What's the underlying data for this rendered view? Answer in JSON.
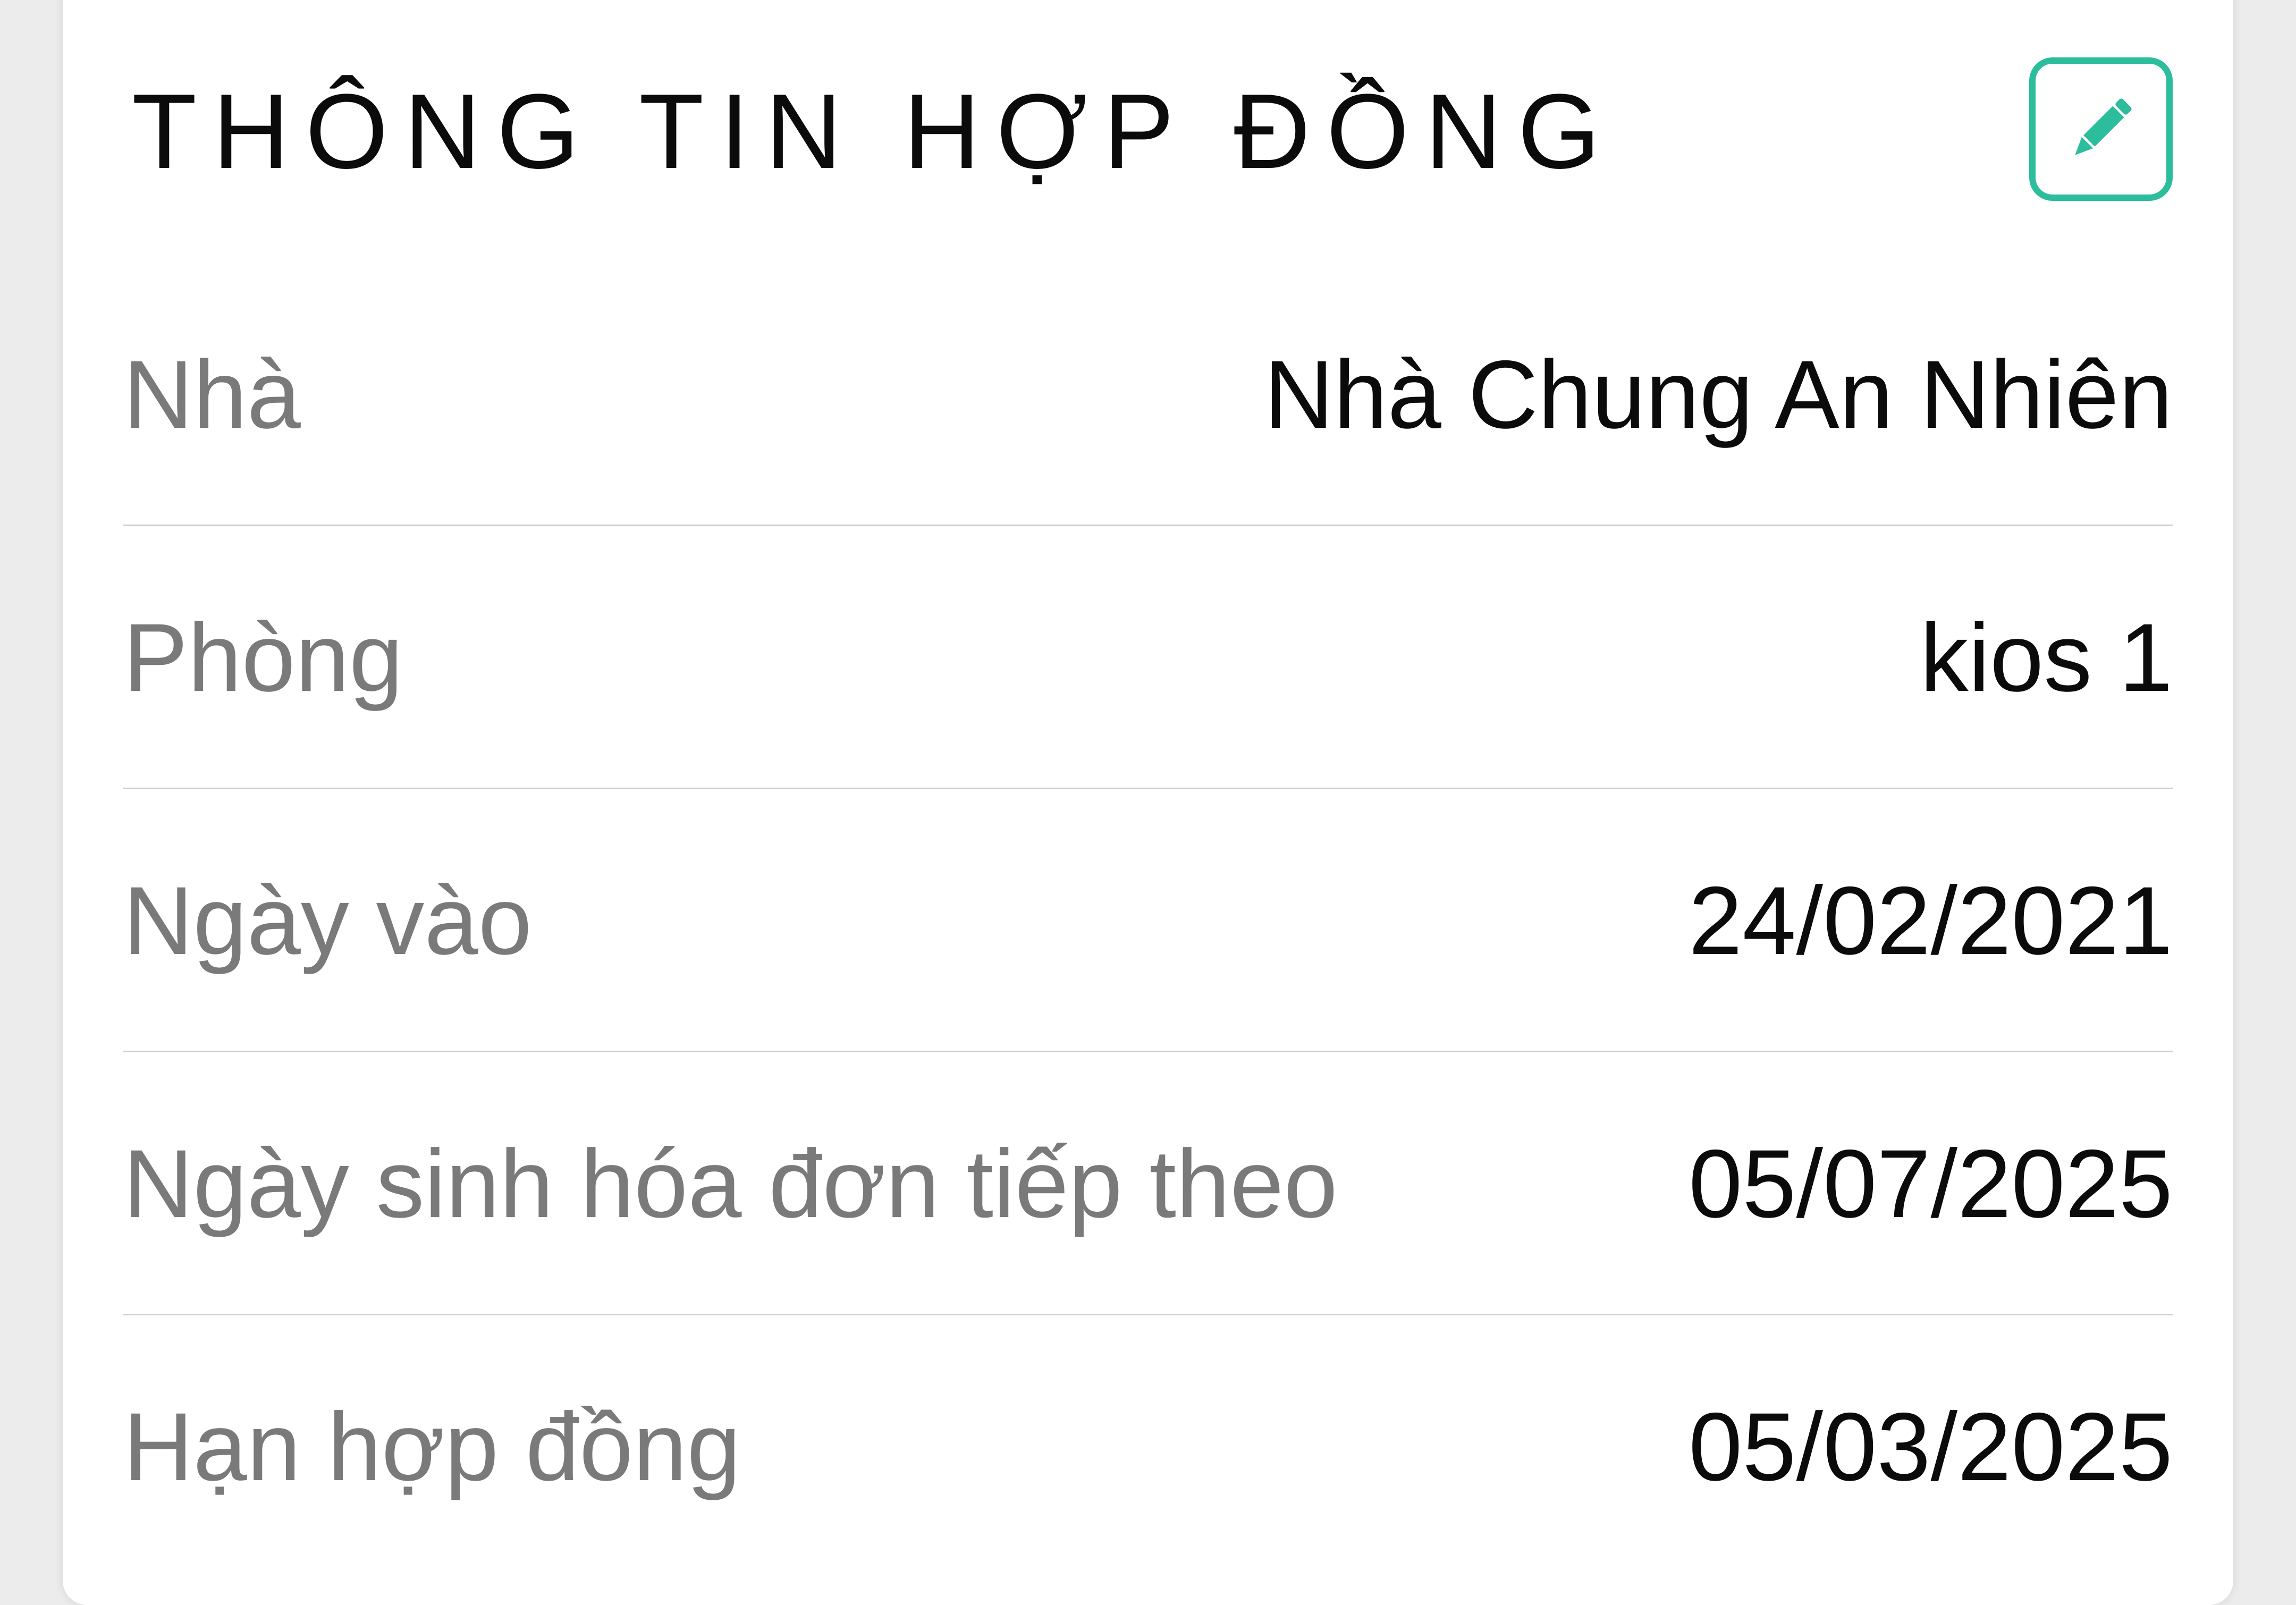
{
  "contract": {
    "title": "THÔNG TIN HỢP ĐỒNG",
    "edit_icon": "pencil-icon",
    "accent_color": "#2bbd9c",
    "rows": [
      {
        "label": "Nhà",
        "value": "Nhà Chung An Nhiên"
      },
      {
        "label": "Phòng",
        "value": "kios 1"
      },
      {
        "label": "Ngày vào",
        "value": "24/02/2021"
      },
      {
        "label": "Ngày sinh hóa đơn tiếp theo",
        "value": "05/07/2025"
      },
      {
        "label": "Hạn hợp đồng",
        "value": "05/03/2025"
      }
    ]
  }
}
